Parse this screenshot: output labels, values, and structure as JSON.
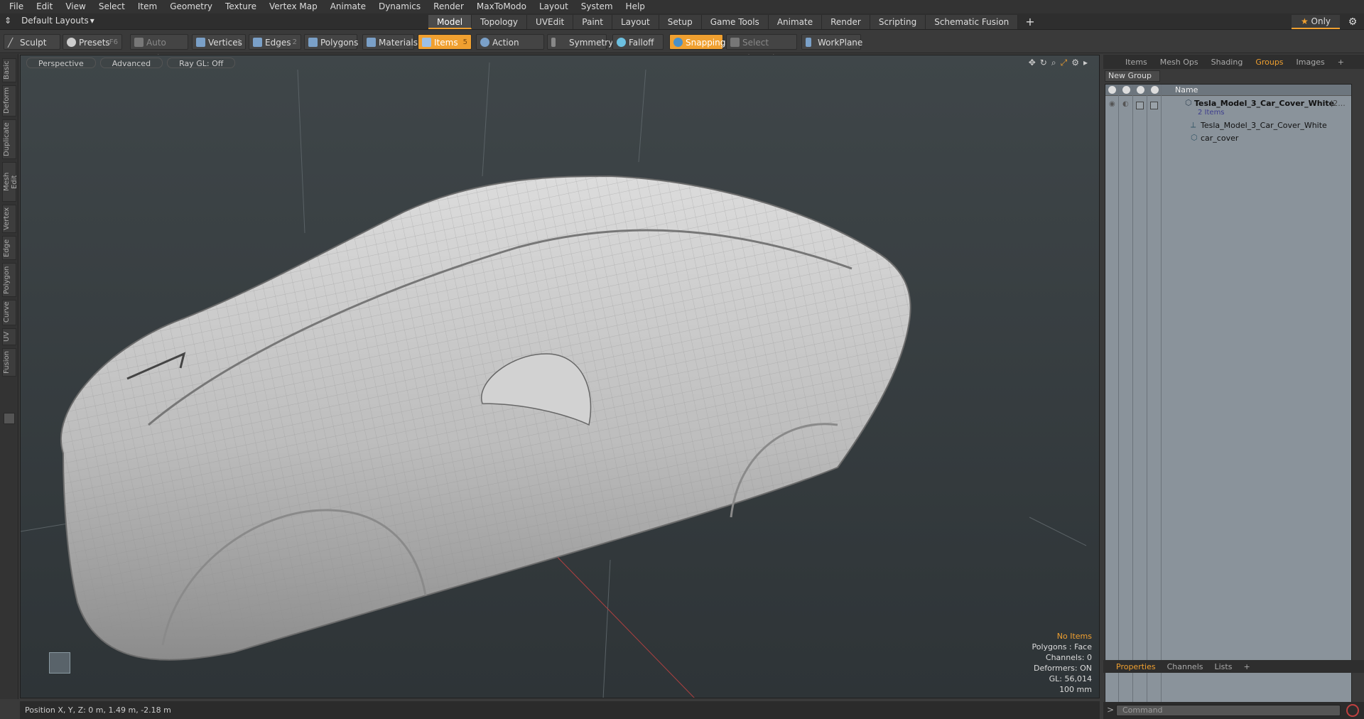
{
  "menu": [
    "File",
    "Edit",
    "View",
    "Select",
    "Item",
    "Geometry",
    "Texture",
    "Vertex Map",
    "Animate",
    "Dynamics",
    "Render",
    "MaxToModo",
    "Layout",
    "System",
    "Help"
  ],
  "layouts_label": "Default Layouts",
  "mode_tabs": [
    "Model",
    "Topology",
    "UVEdit",
    "Paint",
    "Layout",
    "Setup",
    "Game Tools",
    "Animate",
    "Render",
    "Scripting",
    "Schematic Fusion"
  ],
  "active_mode": "Model",
  "only_label": "Only",
  "toolbar": {
    "sculpt": "Sculpt",
    "presets": "Presets",
    "presets_key": "F6",
    "auto_select": "Auto Select",
    "vertices": "Vertices",
    "vertices_count": "1",
    "edges": "Edges",
    "edges_count": "2",
    "polygons": "Polygons",
    "materials": "Materials",
    "items": "Items",
    "items_count": "5",
    "action_center": "Action Center",
    "symmetry": "Symmetry",
    "falloff": "Falloff",
    "snapping": "Snapping",
    "select_through": "Select Through",
    "workplane": "WorkPlane"
  },
  "left_tabs": [
    "Basic",
    "Deform",
    "Duplicate",
    "Mesh Edit",
    "Vertex",
    "Edge",
    "Polygon",
    "Curve",
    "UV",
    "Fusion"
  ],
  "viewport": {
    "view": "Perspective",
    "shading": "Advanced",
    "raygl": "Ray GL: Off",
    "info": [
      "No Items",
      "Polygons : Face",
      "Channels: 0",
      "Deformers: ON",
      "GL: 56,014",
      "100 mm"
    ]
  },
  "status": "Position X, Y, Z:  0 m, 1.49 m, -2.18 m",
  "right_tabs": [
    "Items",
    "Mesh Ops",
    "Shading",
    "Groups",
    "Images"
  ],
  "active_right_tab": "Groups",
  "new_group": "New Group",
  "grid_header": "Name",
  "tree": {
    "root": "Tesla_Model_3_Car_Cover_White",
    "root_suffix": "(2...",
    "count": "2 Items",
    "child1": "Tesla_Model_3_Car_Cover_White",
    "child2": "car_cover"
  },
  "bottom_tabs": [
    "Properties",
    "Channels",
    "Lists"
  ],
  "active_bottom_tab": "Properties",
  "command_placeholder": "Command",
  "colors": {
    "accent": "#f0a030",
    "viewport_bg": "#343b3e",
    "car": "#c9c9c9"
  }
}
